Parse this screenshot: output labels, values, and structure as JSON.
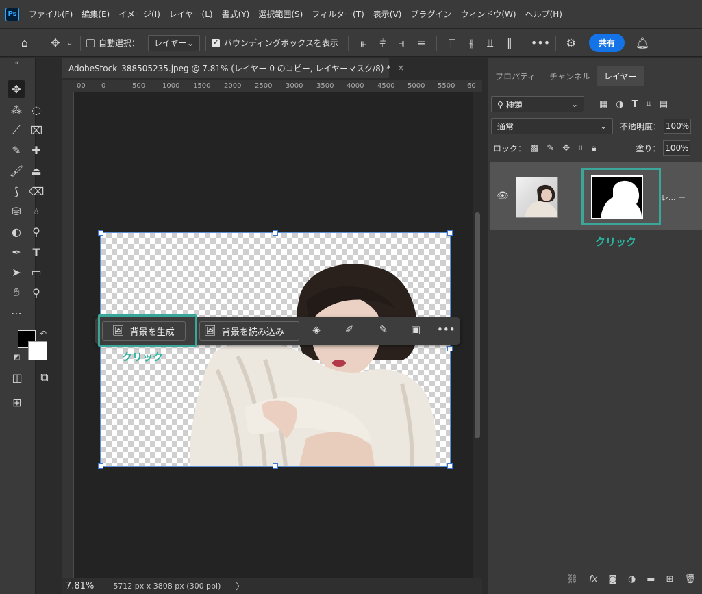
{
  "menu": {
    "logo": "Ps",
    "items": [
      "ファイル(F)",
      "編集(E)",
      "イメージ(I)",
      "レイヤー(L)",
      "書式(Y)",
      "選択範囲(S)",
      "フィルター(T)",
      "表示(V)",
      "プラグイン",
      "ウィンドウ(W)",
      "ヘルプ(H)"
    ]
  },
  "options": {
    "auto_select_label": "自動選択：",
    "auto_select_value": "レイヤー",
    "bbox_label": "バウンディングボックスを表示",
    "share_label": "共有"
  },
  "document": {
    "tab_title": "AdobeStock_388505235.jpeg @ 7.81% (レイヤー 0 のコピー, レイヤーマスク/8) *",
    "close": "×"
  },
  "ruler": {
    "top_labels": [
      "00",
      "0",
      "500",
      "1000",
      "1500",
      "2000",
      "2500",
      "3000",
      "3500",
      "4000",
      "4500",
      "5000",
      "5500",
      "60"
    ]
  },
  "taskbar": {
    "generate_bg": "背景を生成",
    "import_bg": "背景を読み込み"
  },
  "annotations": {
    "click_left": "クリック",
    "click_right": "クリック",
    "highlight_color": "#3aa79a"
  },
  "status": {
    "zoom": "7.81%",
    "dimensions": "5712 px x 3808 px (300 ppi)",
    "arrow": "〉"
  },
  "panel": {
    "tabs": [
      "プロパティ",
      "チャンネル",
      "レイヤー"
    ],
    "filter_kind": "種類",
    "blend_mode": "通常",
    "opacity_label": "不透明度：",
    "opacity_value": "100%",
    "lock_label": "ロック：",
    "fill_label": "塗り：",
    "fill_value": "100%",
    "layer_name": "レ... ー"
  }
}
